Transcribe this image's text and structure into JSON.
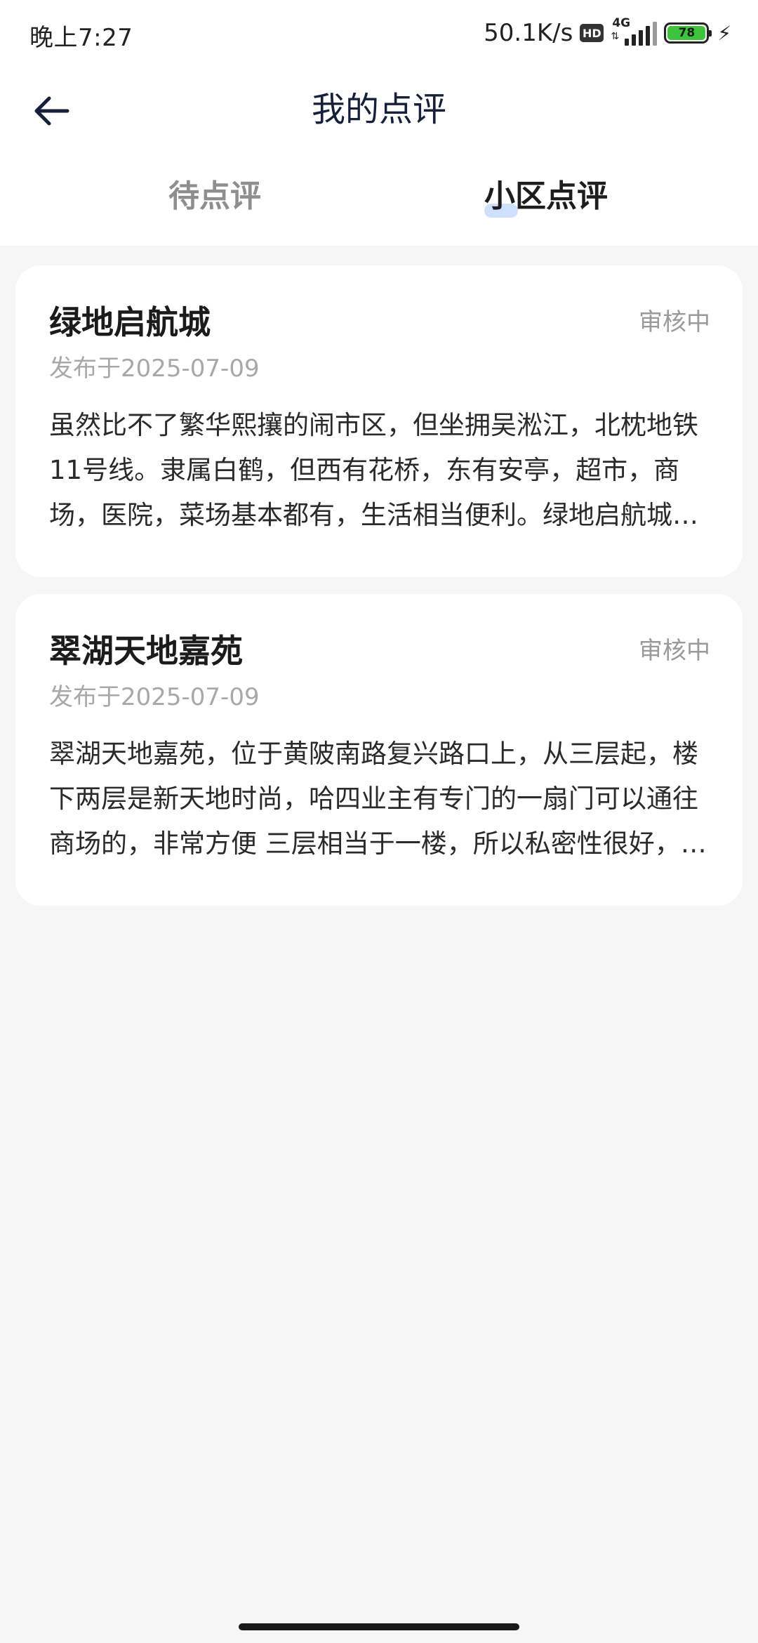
{
  "status_bar": {
    "time": "晚上7:27",
    "network_speed": "50.1K/s",
    "hd_badge": "HD",
    "network_type": "4G",
    "battery_level": "78",
    "charging_icon": "bolt-icon"
  },
  "header": {
    "back_icon": "arrow-left-icon",
    "title": "我的点评"
  },
  "tabs": [
    {
      "label": "待点评",
      "active": false
    },
    {
      "label": "小区点评",
      "active": true
    }
  ],
  "reviews": [
    {
      "title": "绿地启航城",
      "status": "审核中",
      "date": "发布于2025-07-09",
      "body": "虽然比不了繁华熙攘的闹市区，但坐拥吴淞江，北枕地铁11号线。隶属白鹤，但西有花桥，东有安亭，超市，商场，医院，菜场基本都有，生活相当便利。绿地启航城小区环境优美，绿化率高，物业管理规范，居住体验很好。"
    },
    {
      "title": "翠湖天地嘉苑",
      "status": "审核中",
      "date": "发布于2025-07-09",
      "body": "翠湖天地嘉苑，位于黄陂南路复兴路口上，从三层起，楼下两层是新天地时尚，哈四业主有专门的一扇门可以通往商场的，非常方便 三层相当于一楼，所以私密性很好，小区绿化与安保都非常出色。"
    }
  ],
  "colors": {
    "accent_underline": "#cfe0ff",
    "battery_fill": "#3ec43c",
    "background": "#f6f6f6"
  }
}
